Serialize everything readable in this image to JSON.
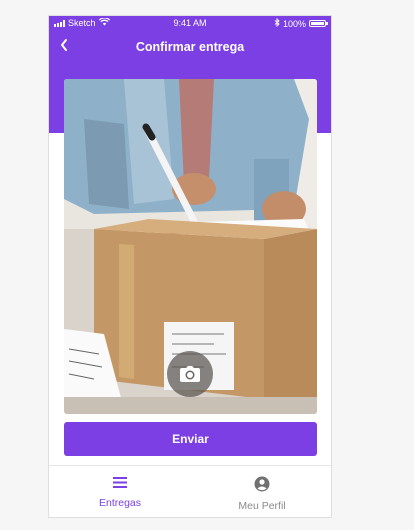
{
  "status_bar": {
    "carrier": "Sketch",
    "time": "9:41 AM",
    "battery": "100%"
  },
  "header": {
    "back_icon": "chevron-left-icon",
    "title": "Confirmar entrega"
  },
  "photo": {
    "camera_icon": "camera-icon"
  },
  "actions": {
    "send_label": "Enviar"
  },
  "tabbar": {
    "items": [
      {
        "label": "Entregas",
        "icon": "list-icon",
        "active": true
      },
      {
        "label": "Meu Perfil",
        "icon": "user-circle-icon",
        "active": false
      }
    ]
  },
  "colors": {
    "brand": "#7b3fe4",
    "inactive_tab": "#8a8a8a"
  }
}
